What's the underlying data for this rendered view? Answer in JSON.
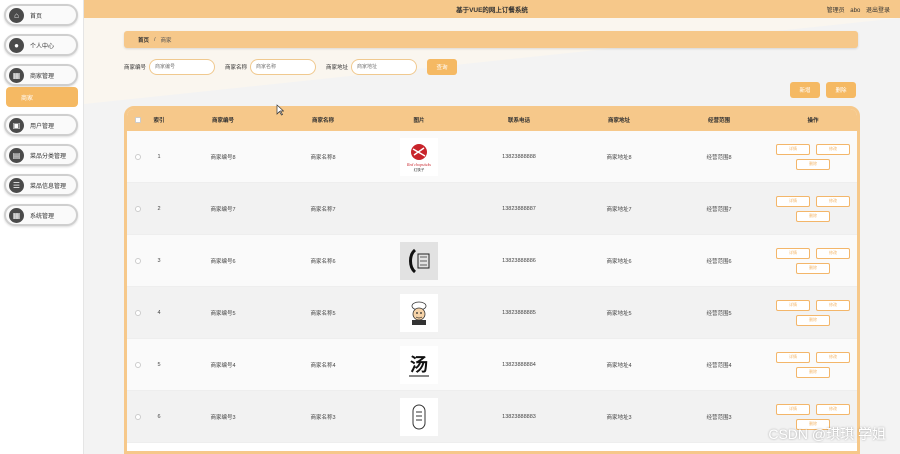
{
  "app": {
    "title": "基于VUE的网上订餐系统"
  },
  "header": {
    "role": "管理员",
    "user": "abo",
    "logout": "退出登录"
  },
  "sidebar": {
    "items": [
      {
        "label": "首页",
        "icon": "home-icon",
        "glyph": "⌂"
      },
      {
        "label": "个人中心",
        "icon": "user-icon",
        "glyph": "●"
      },
      {
        "label": "商家管理",
        "icon": "grid-icon",
        "glyph": "▦"
      },
      {
        "label": "用户管理",
        "icon": "user-manage-icon",
        "glyph": "▣"
      },
      {
        "label": "菜品分类管理",
        "icon": "category-icon",
        "glyph": "▤"
      },
      {
        "label": "菜品信息管理",
        "icon": "list-icon",
        "glyph": "☰"
      },
      {
        "label": "系统管理",
        "icon": "settings-icon",
        "glyph": "▦"
      }
    ],
    "sub_item": "商家"
  },
  "breadcrumb": {
    "home": "首页",
    "separator": "/",
    "current": "商家"
  },
  "search": {
    "no_label": "商家编号",
    "no_placeholder": "商家编号",
    "name_label": "商家名称",
    "name_placeholder": "商家名称",
    "addr_label": "商家地址",
    "addr_placeholder": "商家地址",
    "button": "查询"
  },
  "actions": {
    "add": "新增",
    "delete": "删除"
  },
  "table": {
    "headers": {
      "index": "索引",
      "no": "商家编号",
      "name": "商家名称",
      "image": "图片",
      "tel": "联系电话",
      "addr": "商家地址",
      "scope": "经营范围",
      "ops": "操作"
    },
    "op_labels": {
      "detail": "详情",
      "edit": "修改",
      "delete": "删除"
    },
    "rows": [
      {
        "index": "1",
        "no": "商家编号8",
        "name": "商家名称8",
        "tel": "13823888888",
        "addr": "商家地址8",
        "scope": "经营范围8",
        "logo": "red-logo",
        "logo_text": "Red chopsticks",
        "logo_sub": "红筷子"
      },
      {
        "index": "2",
        "no": "商家编号7",
        "name": "商家名称7",
        "tel": "13823888887",
        "addr": "商家地址7",
        "scope": "经营范围7",
        "logo": "none"
      },
      {
        "index": "3",
        "no": "商家编号6",
        "name": "商家名称6",
        "tel": "13823888886",
        "addr": "商家地址6",
        "scope": "经营范围6",
        "logo": "grey-logo"
      },
      {
        "index": "4",
        "no": "商家编号5",
        "name": "商家名称5",
        "tel": "13823888885",
        "addr": "商家地址5",
        "scope": "经营范围5",
        "logo": "chef-logo"
      },
      {
        "index": "5",
        "no": "商家编号4",
        "name": "商家名称4",
        "tel": "13823888884",
        "addr": "商家地址4",
        "scope": "经营范围4",
        "logo": "soup-logo",
        "logo_text": "汤"
      },
      {
        "index": "6",
        "no": "商家编号3",
        "name": "商家名称3",
        "tel": "13823888883",
        "addr": "商家地址3",
        "scope": "经营范围3",
        "logo": "stamp-logo"
      }
    ]
  },
  "watermark": "CSDN @琪琪 学姐",
  "colors": {
    "accent": "#f5b963",
    "header": "#f6c88a"
  }
}
